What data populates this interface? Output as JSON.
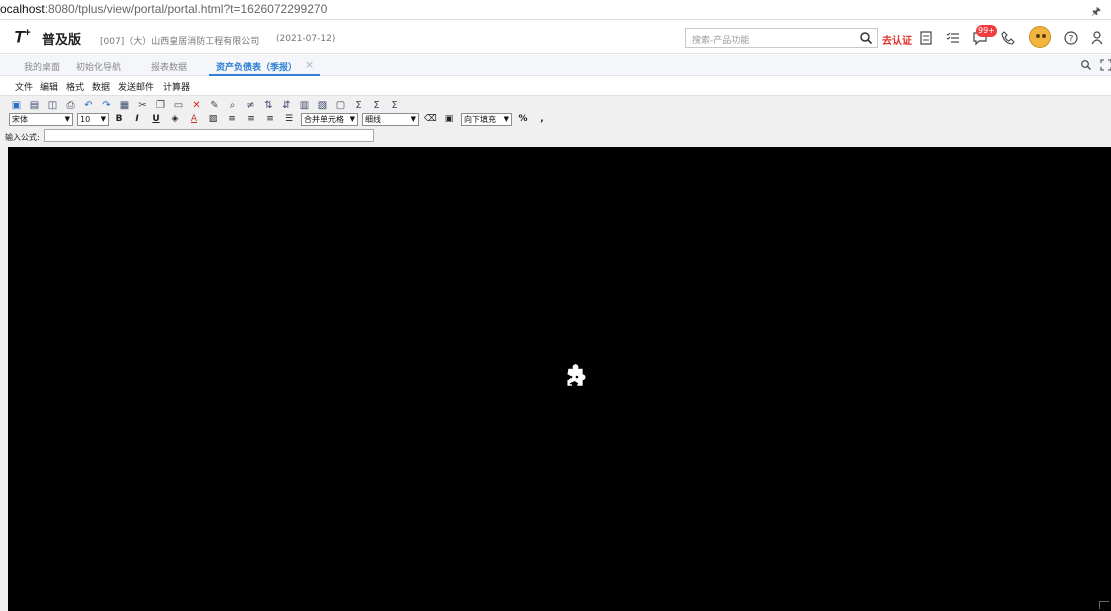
{
  "browser": {
    "url_host": "ocalhost",
    "url_rest": ":8080/tplus/view/portal/portal.html?t=1626072299270"
  },
  "header": {
    "logo": "T",
    "logo_sup": "+",
    "edition": "普及版",
    "company": "[007]（大）山西皇居消防工程有限公司",
    "date": "(2021-07-12)",
    "search_placeholder": "搜索-产品功能",
    "verify_label": "去认证",
    "notification_count": "99+"
  },
  "tabs": [
    {
      "label": "我的桌面"
    },
    {
      "label": "初始化导航"
    },
    {
      "label": "报表数据"
    },
    {
      "label": "资产负债表（季报）"
    }
  ],
  "menu": [
    "文件",
    "编辑",
    "格式",
    "数据",
    "发送邮件",
    "计算器"
  ],
  "toolbar": {
    "font": "宋体",
    "size": "10",
    "bold": "B",
    "italic": "I",
    "underline": "U",
    "merge": "合并单元格",
    "border": "细线",
    "fill": "向下填充",
    "percent": "%",
    "comma": ","
  },
  "formula": {
    "label": "输入公式:"
  }
}
